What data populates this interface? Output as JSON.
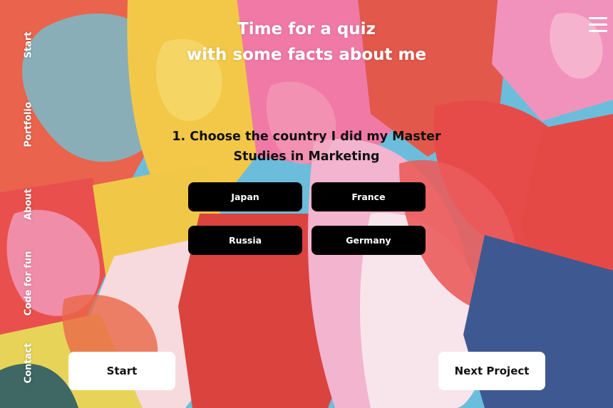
{
  "sidebar": {
    "items": [
      {
        "label": "Start"
      },
      {
        "label": "Portfolio"
      },
      {
        "label": "About"
      },
      {
        "label": "Code for fun"
      },
      {
        "label": "Contact"
      }
    ]
  },
  "header": {
    "title_line1": "Time for a quiz",
    "title_line2": "with some facts about me",
    "menu_icon": "hamburger-menu-icon"
  },
  "quiz": {
    "question": "1. Choose the country I did my Master Studies in Marketing",
    "options": [
      {
        "label": "Japan"
      },
      {
        "label": "France"
      },
      {
        "label": "Russia"
      },
      {
        "label": "Germany"
      }
    ]
  },
  "footer": {
    "start_label": "Start",
    "next_label": "Next Project"
  },
  "colors": {
    "button_bg": "#000000",
    "button_text": "#ffffff",
    "pill_bg": "#ffffff",
    "question_text": "#111111"
  }
}
